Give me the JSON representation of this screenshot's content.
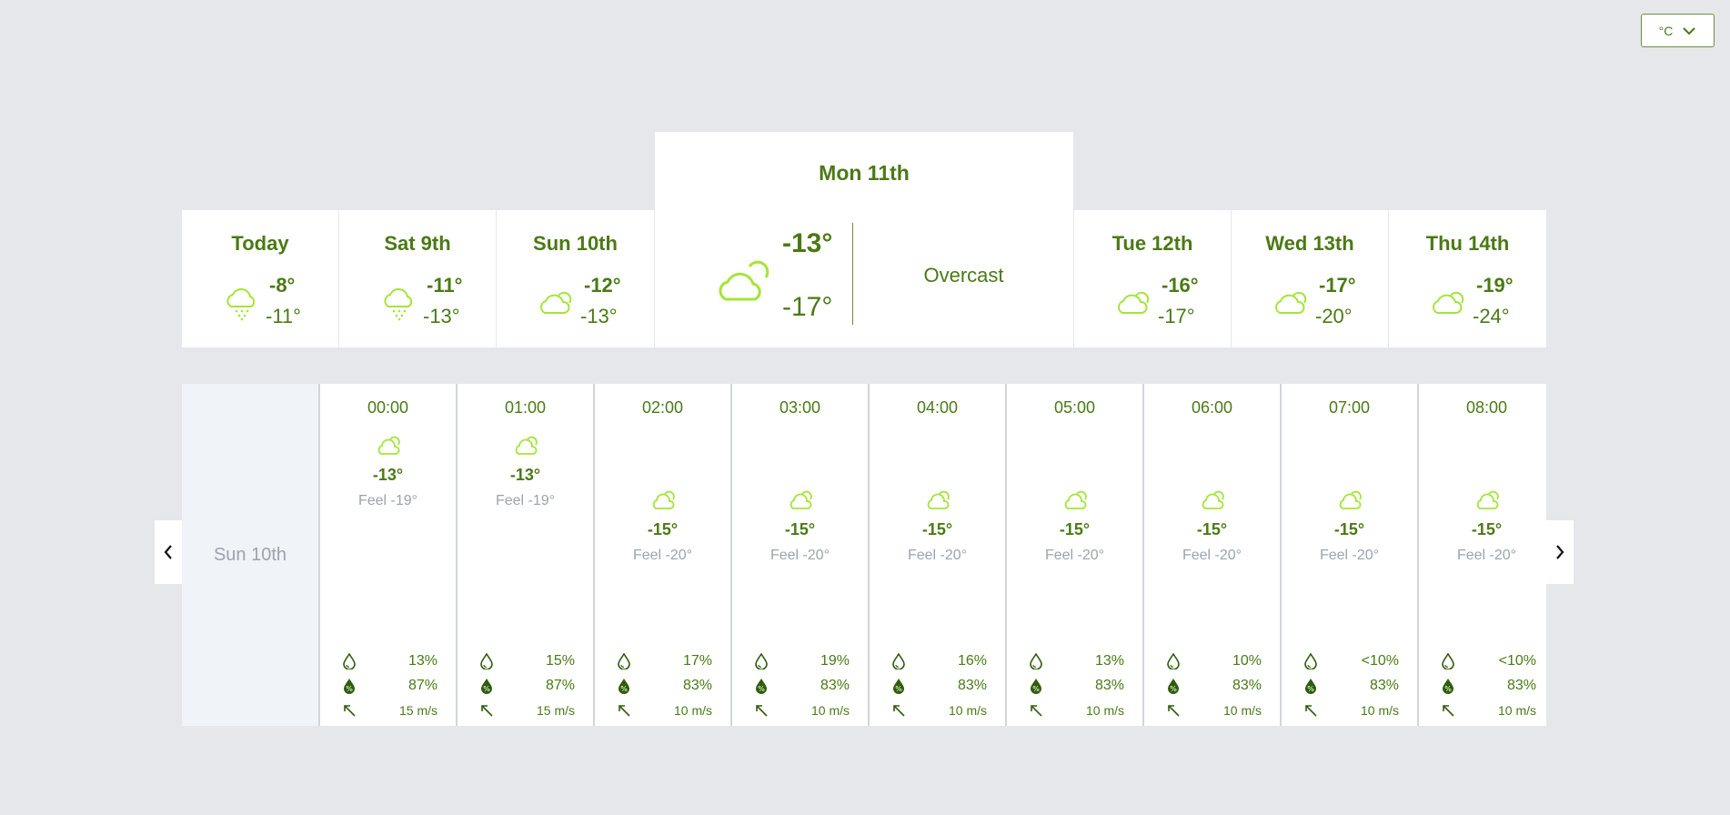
{
  "unit": {
    "label": "°C"
  },
  "colors": {
    "accent": "#4a7a14",
    "icon": "#a3e635",
    "muted": "#9ca3af"
  },
  "days": [
    {
      "title": "Today",
      "hi": "-8°",
      "lo": "-11°",
      "icon": "snow-cloud-icon"
    },
    {
      "title": "Sat 9th",
      "hi": "-11°",
      "lo": "-13°",
      "icon": "snow-cloud-icon"
    },
    {
      "title": "Sun 10th",
      "hi": "-12°",
      "lo": "-13°",
      "icon": "cloud-icon"
    },
    {
      "title": "Tue 12th",
      "hi": "-16°",
      "lo": "-17°",
      "icon": "cloud-icon"
    },
    {
      "title": "Wed 13th",
      "hi": "-17°",
      "lo": "-20°",
      "icon": "cloud-icon"
    },
    {
      "title": "Thu 14th",
      "hi": "-19°",
      "lo": "-24°",
      "icon": "cloud-icon"
    }
  ],
  "selected": {
    "title": "Mon 11th",
    "hi": "-13°",
    "lo": "-17°",
    "description": "Overcast",
    "icon": "cloud-icon"
  },
  "hourly": {
    "day_label": "Sun 10th",
    "hours": [
      {
        "time": "00:00",
        "temp": "-13°",
        "feel": "Feel -19°",
        "precip": "13%",
        "humidity": "87%",
        "wind": "15 m/s"
      },
      {
        "time": "01:00",
        "temp": "-13°",
        "feel": "Feel -19°",
        "precip": "15%",
        "humidity": "87%",
        "wind": "15 m/s"
      },
      {
        "time": "02:00",
        "temp": "-15°",
        "feel": "Feel -20°",
        "precip": "17%",
        "humidity": "83%",
        "wind": "10 m/s"
      },
      {
        "time": "03:00",
        "temp": "-15°",
        "feel": "Feel -20°",
        "precip": "19%",
        "humidity": "83%",
        "wind": "10 m/s"
      },
      {
        "time": "04:00",
        "temp": "-15°",
        "feel": "Feel -20°",
        "precip": "16%",
        "humidity": "83%",
        "wind": "10 m/s"
      },
      {
        "time": "05:00",
        "temp": "-15°",
        "feel": "Feel -20°",
        "precip": "13%",
        "humidity": "83%",
        "wind": "10 m/s"
      },
      {
        "time": "06:00",
        "temp": "-15°",
        "feel": "Feel -20°",
        "precip": "10%",
        "humidity": "83%",
        "wind": "10 m/s"
      },
      {
        "time": "07:00",
        "temp": "-15°",
        "feel": "Feel -20°",
        "precip": "<10%",
        "humidity": "83%",
        "wind": "10 m/s"
      },
      {
        "time": "08:00",
        "temp": "-15°",
        "feel": "Feel -20°",
        "precip": "<10%",
        "humidity": "83%",
        "wind": "10 m/s"
      }
    ]
  }
}
